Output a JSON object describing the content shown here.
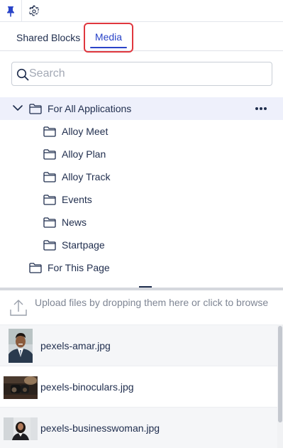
{
  "toolbar": {
    "pin_icon": "pin-icon",
    "settings_icon": "gear-icon"
  },
  "tabs": [
    {
      "label": "Shared Blocks",
      "active": false
    },
    {
      "label": "Media",
      "active": true
    }
  ],
  "search": {
    "placeholder": "Search",
    "value": ""
  },
  "tree": {
    "root": {
      "label": "For All Applications",
      "expanded": true,
      "selected": true
    },
    "children": [
      {
        "label": "Alloy Meet"
      },
      {
        "label": "Alloy Plan"
      },
      {
        "label": "Alloy Track"
      },
      {
        "label": "Events"
      },
      {
        "label": "News"
      },
      {
        "label": "Startpage"
      }
    ],
    "sibling": {
      "label": "For This Page"
    }
  },
  "upload": {
    "text": "Upload files by dropping them here or click to browse"
  },
  "files": [
    {
      "name": "pexels-amar.jpg"
    },
    {
      "name": "pexels-binoculars.jpg"
    },
    {
      "name": "pexels-businesswoman.jpg"
    }
  ],
  "colors": {
    "accent": "#2a44c8",
    "highlight_box": "#e0373e",
    "selected_row": "#eef0fb",
    "text": "#1f2d4d"
  }
}
